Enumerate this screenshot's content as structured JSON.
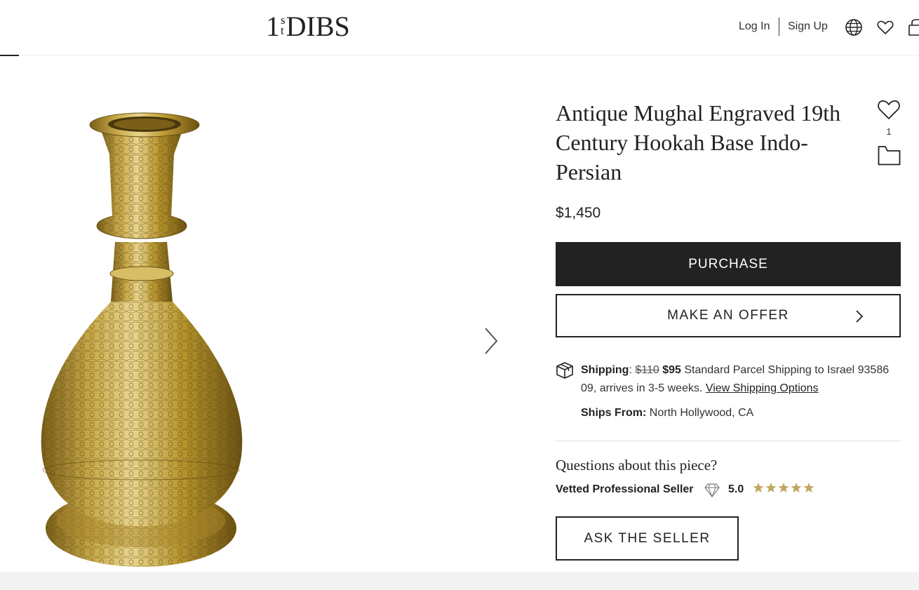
{
  "header": {
    "logo": {
      "main_prefix": "1",
      "superscript_top": "s",
      "superscript_bottom": "t",
      "main_suffix": "DIBS"
    },
    "login_label": "Log In",
    "signup_label": "Sign Up",
    "icons": [
      "globe-icon",
      "heart-icon",
      "bag-icon"
    ]
  },
  "product": {
    "title": "Antique Mughal Engraved 19th Century Hookah Base Indo-Persian",
    "favorite_count": "1",
    "price": "$1,450",
    "image_icon": "hookah-base-image"
  },
  "actions": {
    "purchase_label": "PURCHASE",
    "offer_label": "MAKE AN OFFER",
    "ask_label": "ASK THE SELLER"
  },
  "shipping": {
    "label": "Shipping",
    "colon": ":",
    "old_price": "$110",
    "new_price": "$95",
    "description": "Standard Parcel Shipping to Israel 93586 09, arrives in 3-5 weeks.",
    "link": "View Shipping Options",
    "ships_from_label": "Ships From:",
    "ships_from_value": "North Hollywood, CA"
  },
  "seller": {
    "questions": "Questions about this piece?",
    "vetted": "Vetted Professional Seller",
    "rating": "5.0",
    "stars": 5
  },
  "colors": {
    "accent_dark": "#222222",
    "star": "#c2a661",
    "brass": "#b8962e"
  }
}
